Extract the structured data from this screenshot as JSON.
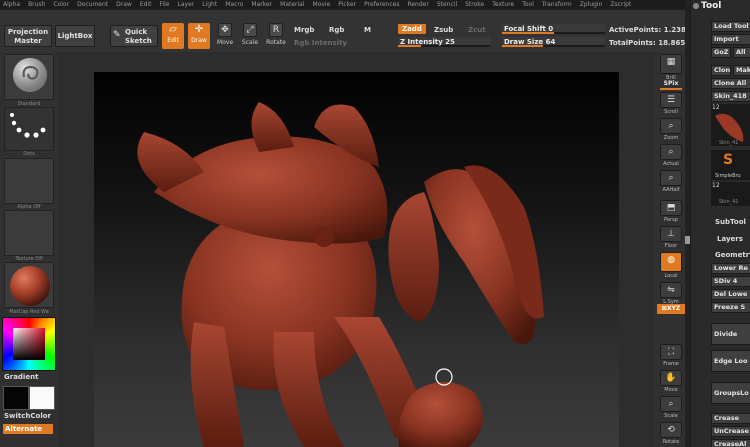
{
  "menu": [
    "Alpha",
    "Brush",
    "Color",
    "Document",
    "Draw",
    "Edit",
    "File",
    "Layer",
    "Light",
    "Macro",
    "Marker",
    "Material",
    "Movie",
    "Picker",
    "Preferences",
    "Render",
    "Stencil",
    "Stroke",
    "Texture",
    "Tool",
    "Transform",
    "Zplugin",
    "Zscript"
  ],
  "toolbar": {
    "projection_master": "Projection Master",
    "lightbox": "LightBox",
    "quick_sketch": "Quick Sketch",
    "edit": "Edit",
    "draw": "Draw",
    "move": "Move",
    "scale": "Scale",
    "rotate": "Rotate",
    "mrgb": "Mrgb",
    "rgb": "Rgb",
    "m": "M",
    "rgb_intensity": "Rgb Intensity",
    "zadd": "Zadd",
    "zsub": "Zsub",
    "zcut": "Zcut",
    "z_intensity": "Z Intensity 25",
    "z_intensity_level": 0.25,
    "focal_shift": "Focal Shift 0",
    "focal_shift_level": 0.5,
    "draw_size": "Draw Size 64",
    "draw_size_level": 0.4,
    "active_points": "ActivePoints: 1.238",
    "total_points": "TotalPoints: 18.865"
  },
  "leftshelf": {
    "brush": "Standard",
    "stroke": "Dots",
    "alpha": "Alpha Off",
    "texture": "Texture Off",
    "material": "MatCap Red Wa",
    "gradient": "Gradient",
    "switch_color": "SwitchColor",
    "alternate": "Alternate"
  },
  "rightshelf": {
    "brill": "Brill",
    "spix": "SPix",
    "scroll": "Scroll",
    "zoom": "Zoom",
    "actual": "Actual",
    "aahalf": "AAHalf",
    "persp": "Persp",
    "floor": "Floor",
    "local": "Local",
    "lsym": "L.Sym",
    "xyz": "⊠XYZ",
    "frame": "Frame",
    "move": "Move",
    "scale": "Scale",
    "rotate": "Rotate"
  },
  "toolpalette": {
    "title": "Tool",
    "load_tool": "Load Tool",
    "import": "Import",
    "goz": "GoZ",
    "all": "All",
    "clone": "Clone",
    "make": "Make",
    "clone_all": "Clone All",
    "skin_top": "Skin_418",
    "count1": "12",
    "skin_cap": "Skin_41",
    "simplebrush": "SimpleBru",
    "count2": "12",
    "skin_cap2": "Skin_41",
    "subtool": "SubTool",
    "layers": "Layers",
    "geometry": "Geometry",
    "lower_res": "Lower Re",
    "sdiv": "SDiv 4",
    "del_lower": "Del Lowe",
    "freeze": "Freeze S",
    "divide": "Divide",
    "edge_loop": "Edge Loo",
    "groupsloop": "GroupsLo",
    "crease": "Crease",
    "uncrease": "UnCrease",
    "crease_all": "CreaseAl"
  },
  "colors": {
    "accent": "#e07a22",
    "material": "#8b3a26"
  }
}
